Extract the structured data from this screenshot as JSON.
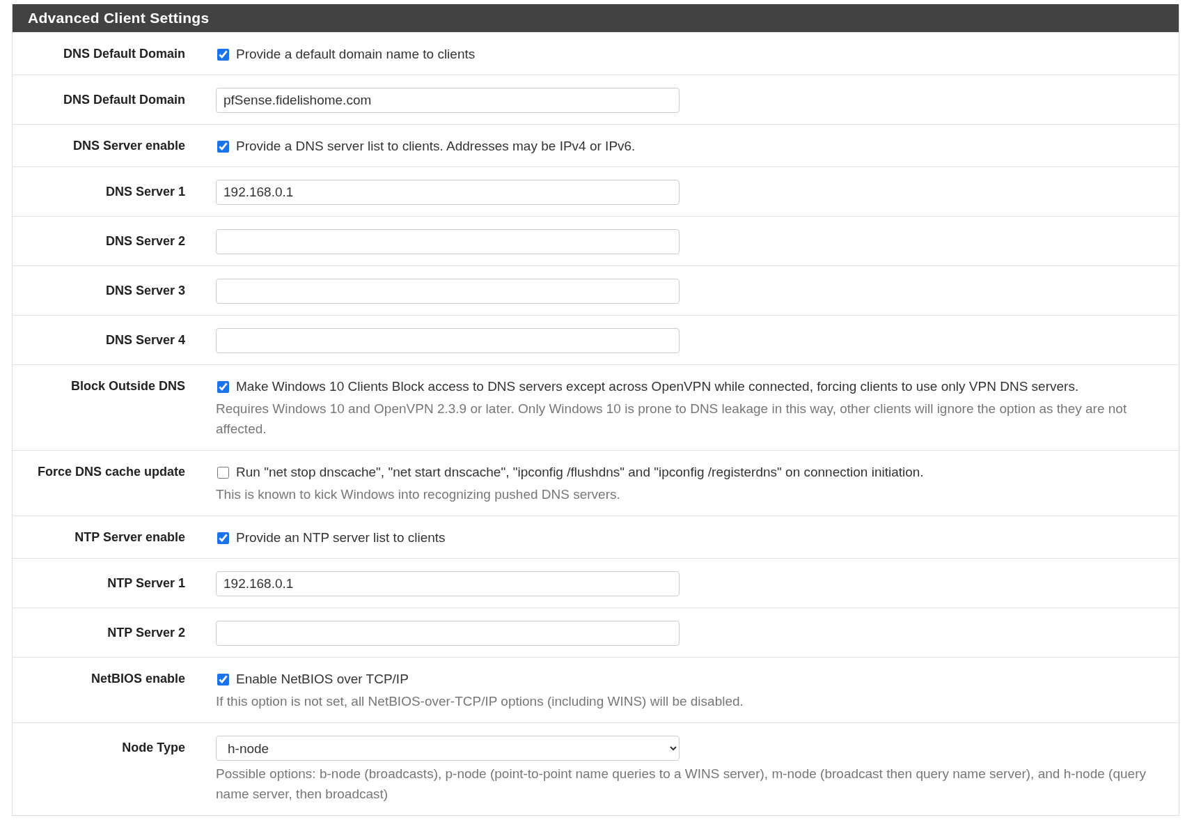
{
  "panel": {
    "title": "Advanced Client Settings"
  },
  "rows": [
    {
      "label": "DNS Default Domain",
      "kind": "checkbox",
      "checked": true,
      "text": "Provide a default domain name to clients"
    },
    {
      "label": "DNS Default Domain",
      "kind": "input",
      "value": "pfSense.fidelishome.com"
    },
    {
      "label": "DNS Server enable",
      "kind": "checkbox",
      "checked": true,
      "text": "Provide a DNS server list to clients. Addresses may be IPv4 or IPv6."
    },
    {
      "label": "DNS Server 1",
      "kind": "input",
      "value": "192.168.0.1"
    },
    {
      "label": "DNS Server 2",
      "kind": "input"
    },
    {
      "label": "DNS Server 3",
      "kind": "input"
    },
    {
      "label": "DNS Server 4",
      "kind": "input"
    },
    {
      "label": "Block Outside DNS",
      "kind": "checkbox",
      "checked": true,
      "text": "Make Windows 10 Clients Block access to DNS servers except across OpenVPN while connected, forcing clients to use only VPN DNS servers.",
      "help": "Requires Windows 10 and OpenVPN 2.3.9 or later. Only Windows 10 is prone to DNS leakage in this way, other clients will ignore the option as they are not affected."
    },
    {
      "label": "Force DNS cache update",
      "kind": "checkbox",
      "checked": false,
      "text": "Run \"net stop dnscache\", \"net start dnscache\", \"ipconfig /flushdns\" and \"ipconfig /registerdns\" on connection initiation.",
      "help": "This is known to kick Windows into recognizing pushed DNS servers."
    },
    {
      "label": "NTP Server enable",
      "kind": "checkbox",
      "checked": true,
      "text": "Provide an NTP server list to clients"
    },
    {
      "label": "NTP Server 1",
      "kind": "input",
      "value": "192.168.0.1"
    },
    {
      "label": "NTP Server 2",
      "kind": "input"
    },
    {
      "label": "NetBIOS enable",
      "kind": "checkbox",
      "checked": true,
      "text": "Enable NetBIOS over TCP/IP",
      "help": "If this option is not set, all NetBIOS-over-TCP/IP options (including WINS) will be disabled."
    },
    {
      "label": "Node Type",
      "kind": "select",
      "value": "h-node",
      "help": "Possible options: b-node (broadcasts), p-node (point-to-point name queries to a WINS server), m-node (broadcast then query name server), and h-node (query name server, then broadcast)"
    }
  ]
}
